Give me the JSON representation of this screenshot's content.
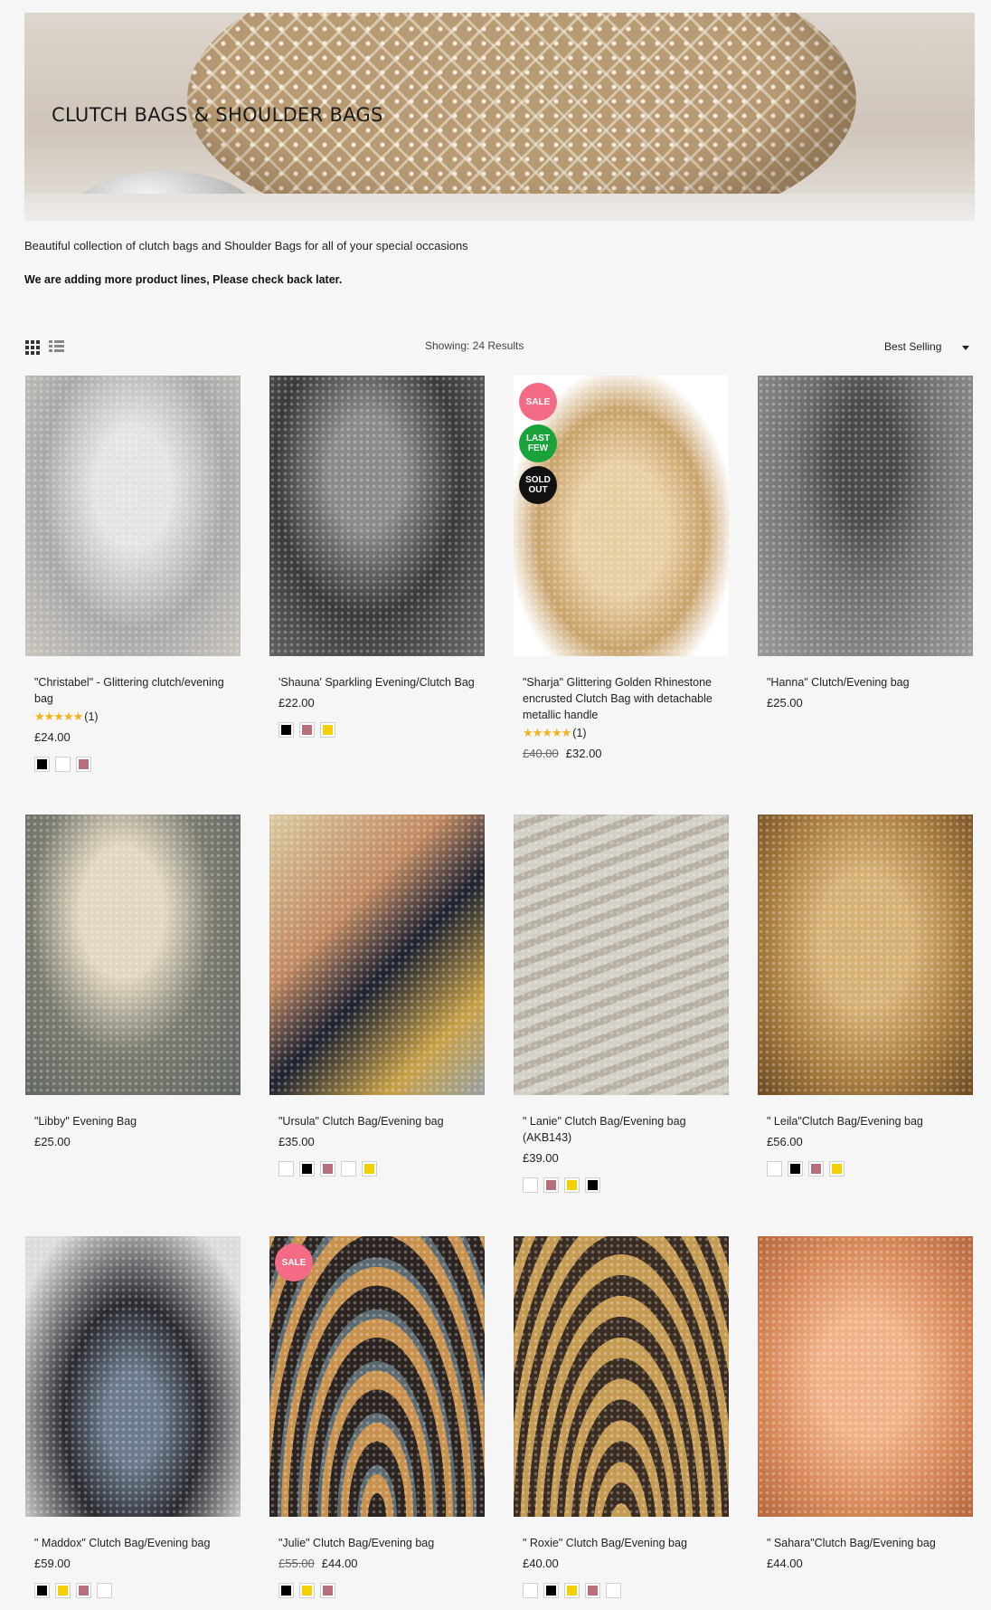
{
  "banner": {
    "title": "CLUTCH BAGS & SHOULDER BAGS"
  },
  "intro": "Beautiful collection of clutch bags  and Shoulder Bags for all of your special occasions",
  "notice": "We are adding more product lines, Please check back later.",
  "toolbar": {
    "results": "Showing: 24 Results",
    "sort": "Best Selling"
  },
  "colors": {
    "black": "#000000",
    "white": "#ffffff",
    "rose": "#b86f7c",
    "yellow": "#f5d000",
    "sale": "#f46b86",
    "last_few": "#1aa33b",
    "sold_out": "#111111",
    "star": "#f1b31c"
  },
  "products": [
    {
      "name": "\"Christabel\" - Glittering clutch/evening bag",
      "stars": "★★★★★",
      "rating_count": "(1)",
      "price": "£24.00",
      "old_price": "",
      "badges": [],
      "swatches": [
        "black",
        "white",
        "rose"
      ]
    },
    {
      "name": "'Shauna' Sparkling Evening/Clutch Bag",
      "price": "£22.00",
      "old_price": "",
      "badges": [],
      "swatches": [
        "black",
        "rose",
        "yellow"
      ]
    },
    {
      "name": "\"Sharja\" Glittering Golden Rhinestone encrusted Clutch Bag with detachable metallic handle",
      "stars": "★★★★★",
      "rating_count": "(1)",
      "price": "£32.00",
      "old_price": "£40.00",
      "badges": [
        "SALE",
        "LAST FEW",
        "SOLD OUT"
      ],
      "swatches": []
    },
    {
      "name": "\"Hanna\" Clutch/Evening bag",
      "price": "£25.00",
      "old_price": "",
      "badges": [],
      "swatches": []
    },
    {
      "name": "\"Libby\" Evening Bag",
      "price": "£25.00",
      "old_price": "",
      "badges": [],
      "swatches": []
    },
    {
      "name": "\"Ursula\" Clutch Bag/Evening bag",
      "price": "£35.00",
      "old_price": "",
      "badges": [],
      "swatches": [
        "white",
        "black",
        "rose",
        "white",
        "yellow"
      ]
    },
    {
      "name": "\" Lanie\" Clutch Bag/Evening bag (AKB143)",
      "price": "£39.00",
      "old_price": "",
      "badges": [],
      "swatches": [
        "white",
        "rose",
        "yellow",
        "black"
      ]
    },
    {
      "name": "\" Leila\"Clutch Bag/Evening bag",
      "price": "£56.00",
      "old_price": "",
      "badges": [],
      "swatches": [
        "white",
        "black",
        "rose",
        "yellow"
      ]
    },
    {
      "name": "\" Maddox\" Clutch Bag/Evening bag",
      "price": "£59.00",
      "old_price": "",
      "badges": [],
      "swatches": [
        "black",
        "yellow",
        "rose",
        "white"
      ]
    },
    {
      "name": "\"Julie\" Clutch Bag/Evening bag",
      "price": "£44.00",
      "old_price": "£55.00",
      "badges": [
        "SALE"
      ],
      "swatches": [
        "black",
        "yellow",
        "rose"
      ]
    },
    {
      "name": "\" Roxie\" Clutch Bag/Evening bag",
      "price": "£40.00",
      "old_price": "",
      "badges": [],
      "swatches": [
        "white",
        "black",
        "yellow",
        "rose",
        "white"
      ]
    },
    {
      "name": "\" Sahara\"Clutch Bag/Evening bag",
      "price": "£44.00",
      "old_price": "",
      "badges": [],
      "swatches": []
    }
  ]
}
